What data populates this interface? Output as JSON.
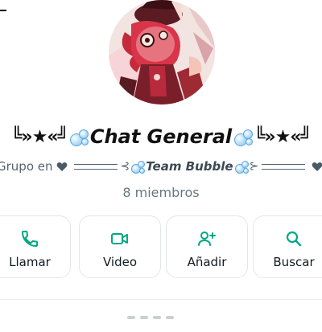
{
  "header": {
    "back_icon": "back-arrow-icon"
  },
  "profile": {
    "avatar_icon": "group-avatar-image"
  },
  "title": {
    "deco_left": "╚»★«╝",
    "name": "Chat General",
    "deco_right": "╚»★«╝",
    "bubble_icon": "bubbles-icon"
  },
  "subtitle": {
    "prefix": "Grupo en",
    "heart_icon": "heart-icon",
    "squiggle_left": "⊰",
    "team": "Team Bubble",
    "squiggle_right": "⊱"
  },
  "members_text": "8 miembros",
  "actions": [
    {
      "label": "Llamar",
      "icon": "phone-icon"
    },
    {
      "label": "Video",
      "icon": "video-icon"
    },
    {
      "label": "Añadir",
      "icon": "add-user-icon"
    },
    {
      "label": "Buscar",
      "icon": "search-icon"
    }
  ],
  "colors": {
    "accent": "#00a884",
    "text_primary": "#111b21",
    "text_secondary": "#667781",
    "card_border": "#e3e6e8"
  }
}
